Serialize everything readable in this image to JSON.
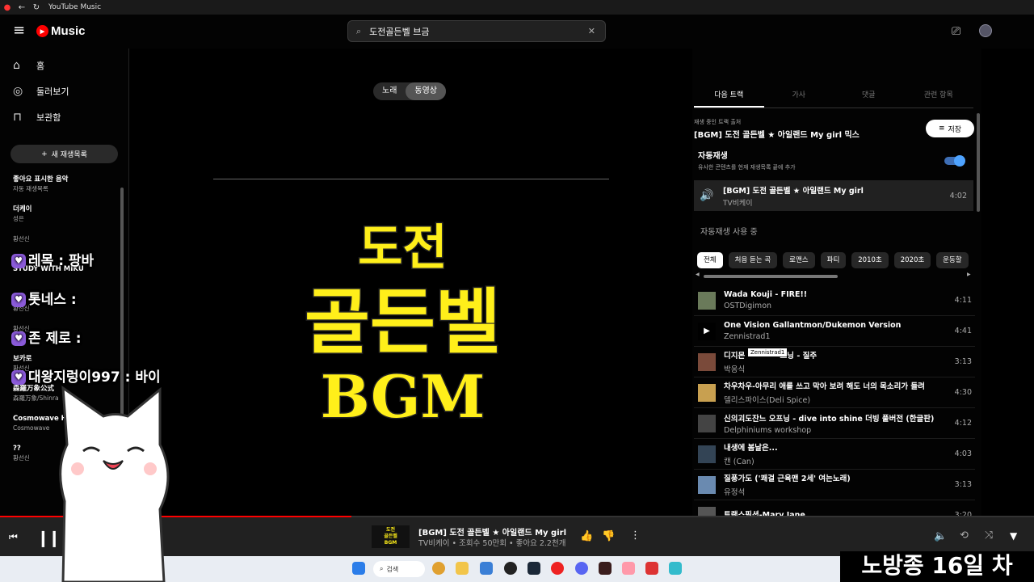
{
  "window": {
    "title": "YouTube Music"
  },
  "header": {
    "logo": "Music",
    "search_value": "도전골든벨 브금"
  },
  "sidebar": {
    "nav": [
      {
        "label": "홈",
        "icon": "home-icon"
      },
      {
        "label": "둘러보기",
        "icon": "compass-icon"
      },
      {
        "label": "보관함",
        "icon": "library-icon"
      }
    ],
    "new_playlist": "새 재생목록",
    "playlists": [
      {
        "title": "좋아요 표시한 음악",
        "subtitle": "자동 재생목록"
      },
      {
        "title": "더케이",
        "subtitle": "성은"
      },
      {
        "title": "",
        "subtitle": "황선신"
      },
      {
        "title": "STUDY WITH MIKU",
        "subtitle": ""
      },
      {
        "title": "브금",
        "subtitle": "황선신"
      },
      {
        "title": "",
        "subtitle": "황선신"
      },
      {
        "title": "보카로",
        "subtitle": "황선신"
      },
      {
        "title": "森羅万象公式",
        "subtitle": "森羅万象/Shinra"
      },
      {
        "title": "Cosmowave H",
        "subtitle": "Cosmowave"
      },
      {
        "title": "??",
        "subtitle": "황선신"
      }
    ]
  },
  "main": {
    "toggle": {
      "song": "노래",
      "video": "동영상"
    },
    "video_text": {
      "line1": "도전",
      "line2": "골든벨",
      "line3": "BGM"
    }
  },
  "right_panel": {
    "tabs": [
      "다음 트랙",
      "가사",
      "댓글",
      "관련 항목"
    ],
    "source_label": "재생 중인 트랙 출처",
    "source_title": "[BGM] 도전 골든벨 ★ 아일랜드 My girl 믹스",
    "save_label": "저장",
    "autoplay_title": "자동재생",
    "autoplay_desc": "유사한 콘텐츠를 현재 재생목록 끝에 추가",
    "autoplay_on": true,
    "current": {
      "title": "[BGM] 도전 골든벨 ★ 아일랜드 My girl",
      "artist": "TV비케이",
      "duration": "4:02"
    },
    "autoplay_in_use": "자동재생 사용 중",
    "chips": [
      "전체",
      "처음 듣는 곡",
      "로맨스",
      "파티",
      "2010초",
      "2020초",
      "운동할"
    ],
    "queue": [
      {
        "title": "Wada Kouji - FIRE!!",
        "artist": "OSTDigimon",
        "duration": "4:11"
      },
      {
        "title": "One Vision Gallantmon/Dukemon Version",
        "artist": "Zennistrad1",
        "duration": "4:41"
      },
      {
        "title": "디지몬",
        "title_tail": "프닝 - 질주",
        "artist": "박응식",
        "duration": "3:13"
      },
      {
        "title": "차우차우-아무리 애를 쓰고 막아 보려 해도 너의 목소리가 들려",
        "artist": "델리스파이스(Deli Spice)",
        "duration": "4:30"
      },
      {
        "title": "신의괴도잔느 오프닝 - dive into shine 더빙 풀버전 (한글판)",
        "artist": "Delphiniums workshop",
        "duration": "4:12"
      },
      {
        "title": "내생에 봄날은...",
        "artist": "캔 (Can)",
        "duration": "4:03"
      },
      {
        "title": "질풍가도 ('쾌걸 근육맨 2세' 여는노래)",
        "artist": "유정석",
        "duration": "3:13"
      },
      {
        "title": "트랜스픽션-Mary Jane",
        "artist": "",
        "duration": "3:20"
      }
    ],
    "tooltip": "Zennistrad1"
  },
  "player": {
    "thumb_text": [
      "도전",
      "골든벨",
      "BGM"
    ],
    "title": "[BGM] 도전 골든벨 ★ 아일랜드 My girl",
    "subtitle": "TV비케이 • 조회수 50만회 • 좋아요 2.2천개",
    "progress": 0.34
  },
  "taskbar": {
    "search": "검색"
  },
  "chat": [
    {
      "text": "레목 : 팡바"
    },
    {
      "text": "톳네스 :"
    },
    {
      "text": "존 제로 :"
    },
    {
      "text": "대왕지렁이997 : 바이"
    }
  ],
  "overlay_text": "노방종 16일 차"
}
